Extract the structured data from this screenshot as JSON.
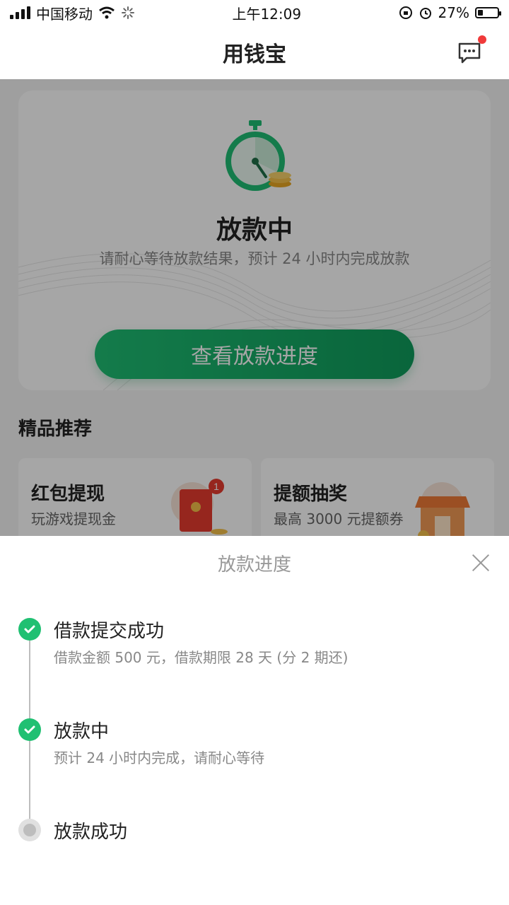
{
  "status_bar": {
    "carrier": "中国移动",
    "time": "上午12:09",
    "battery": "27%",
    "battery_level": 0.27
  },
  "nav": {
    "title": "用钱宝",
    "icons": [
      "message-icon"
    ]
  },
  "hero": {
    "title": "放款中",
    "subtitle": "请耐心等待放款结果，预计 24 小时内完成放款",
    "button": "查看放款进度"
  },
  "recommend": {
    "title": "精品推荐",
    "cards": [
      {
        "title": "红包提现",
        "subtitle": "玩游戏提现金",
        "badge": "1",
        "icon": "red-envelope-icon"
      },
      {
        "title": "提额抽奖",
        "subtitle": "最高 3000 元提额券",
        "icon": "shop-icon"
      }
    ]
  },
  "sheet": {
    "title": "放款进度",
    "steps": [
      {
        "title": "借款提交成功",
        "subtitle": "借款金额 500 元，借款期限 28 天 (分 2 期还)",
        "status": "done"
      },
      {
        "title": "放款中",
        "subtitle": "预计 24 小时内完成，请耐心等待",
        "status": "done"
      },
      {
        "title": "放款成功",
        "subtitle": "",
        "status": "pending"
      }
    ]
  },
  "colors": {
    "accent": "#1fbe73",
    "badge": "#f03a3a"
  }
}
